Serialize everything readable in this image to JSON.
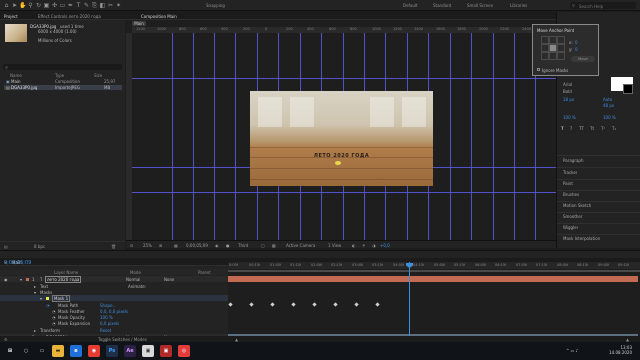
{
  "toolbar": {
    "snapping": "Snapping",
    "workspaces": [
      "Default",
      "Standard",
      "Small Screen",
      "Libraries"
    ],
    "search_placeholder": "Search Help"
  },
  "tabs": {
    "project": "Project",
    "effect_controls": "Effect Controls лето 2020 года",
    "composition": "Composition Main",
    "info": "Info"
  },
  "project": {
    "selected_name": "DGA33P0.jpg",
    "selected_info": "used 1 time",
    "selected_dims": "6000 x 4000 (1.00)",
    "selected_colors": "Millions of Colors",
    "columns": [
      "Name",
      "Type",
      "Size"
    ],
    "items": [
      {
        "name": "Main",
        "type": "Composition",
        "size": "25,97"
      },
      {
        "name": "DGA33P0.jpg",
        "type": "ImporteJPEG",
        "size": "MB"
      }
    ],
    "bpc": "8 bpc"
  },
  "viewer": {
    "tab": "Main",
    "ruler_labels": [
      "1200",
      "1000",
      "800",
      "600",
      "400",
      "200",
      "0",
      "200",
      "400",
      "600",
      "800",
      "1000",
      "1200",
      "1400",
      "1600",
      "1800",
      "2000",
      "2200",
      "2400",
      "2600",
      "2800",
      "3000"
    ],
    "frame_title": "ЛЕТО 2020 ГОДА",
    "zoom": "25%",
    "timecode": "0;00;05;09",
    "resolution": "Third",
    "camera": "Active Camera",
    "views": "1 View",
    "exposure": "+0,0"
  },
  "anchor_dialog": {
    "title": "Move Anchor Point",
    "x_label": "x:",
    "x_value": "0",
    "y_label": "y:",
    "y_value": "0",
    "ignore_mask": "Ignore Masks",
    "move_button": "Move"
  },
  "right_panel": {
    "font": "Arial",
    "style": "Bold",
    "size": "18 px",
    "leading": "Auto",
    "tracking": "48 px",
    "percent_a": "100 %",
    "percent_b": "100 %",
    "sections": [
      "Paragraph",
      "Tracker",
      "Paint",
      "Brushes",
      "Motion Sketch",
      "Smoother",
      "Wiggler",
      "Mask Interpolation"
    ]
  },
  "timeline": {
    "tab": "Main",
    "timecode": "0;00;05;09",
    "columns": [
      "Layer Name",
      "Mode",
      "Parent"
    ],
    "layers": [
      {
        "num": "1",
        "name": "лето 2020 года",
        "mode": "Normal",
        "parent": "None"
      },
      {
        "num": "2",
        "name": "DGA33P0.jpg",
        "mode": "Normal",
        "parent": "None"
      }
    ],
    "properties": [
      {
        "label": "Text",
        "value": "Animate:"
      },
      {
        "label": "Masks",
        "value": ""
      },
      {
        "label": "Mask 1",
        "value": ""
      },
      {
        "label": "Mask Path",
        "value": "Shape..."
      },
      {
        "label": "Mask Feather",
        "value": "0,0, 0,0 pixels"
      },
      {
        "label": "Mask Opacity",
        "value": "100 %"
      },
      {
        "label": "Mask Expansion",
        "value": "0,0 pixels"
      },
      {
        "label": "Transform",
        "value": "Reset"
      }
    ],
    "ruler_ticks": [
      "0:00f",
      "00:15f",
      "01:00f",
      "01:15f",
      "02:00f",
      "02:15f",
      "03:00f",
      "03:15f",
      "04:00f",
      "04:15f",
      "05:00f",
      "05:15f",
      "06:00f",
      "06:15f",
      "07:00f",
      "07:15f",
      "08:00f",
      "08:15f",
      "09:00f",
      "09:15f"
    ],
    "toggle_label": "Toggle Switches / Modes",
    "mode_none": "None",
    "lift_label": "Lift",
    "sub_label": "Subtract"
  },
  "taskbar": {
    "time": "13:03",
    "date": "14.08.2020"
  },
  "colors": {
    "accent_blue": "#3d8fe0",
    "layer1_bar": "#c26a52",
    "layer2_bar": "#5b6f7f"
  }
}
